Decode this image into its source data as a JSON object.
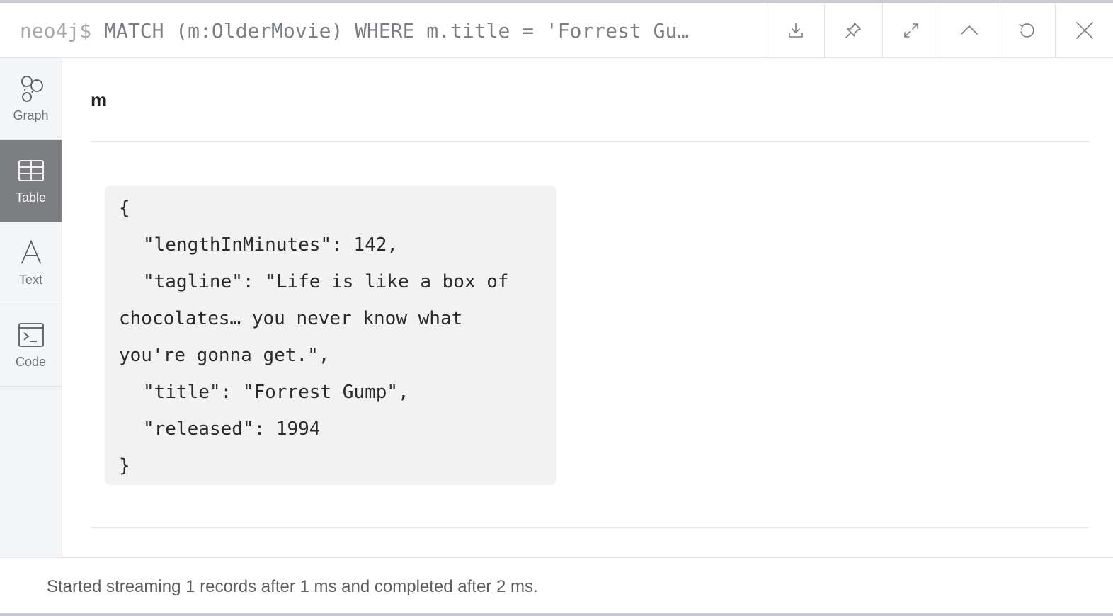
{
  "header": {
    "prompt": "neo4j$",
    "query": "MATCH (m:OlderMovie) WHERE m.title = 'Forrest Gu…",
    "buttons": [
      "download-icon",
      "pin-icon",
      "expand-icon",
      "collapse-up-icon",
      "rerun-icon",
      "close-icon"
    ]
  },
  "sidebar": {
    "items": [
      {
        "label": "Graph",
        "icon": "graph-icon"
      },
      {
        "label": "Table",
        "icon": "table-icon",
        "active": true
      },
      {
        "label": "Text",
        "icon": "text-icon"
      },
      {
        "label": "Code",
        "icon": "code-icon"
      }
    ]
  },
  "result": {
    "column": "m",
    "open_brace": "{",
    "close_brace": "}",
    "line1": "\"lengthInMinutes\": 142,",
    "line2": "\"tagline\": \"Life is like a box of",
    "line3": "chocolates… you never know what",
    "line4": "you're gonna get.\",",
    "line5": "\"title\": \"Forrest Gump\",",
    "line6": "\"released\": 1994"
  },
  "footer": {
    "status": "Started streaming 1 records after 1 ms and completed after 2 ms."
  },
  "colors": {
    "active_tab": "#7c7e81",
    "sidebar_bg": "#f4f5f7",
    "json_bg": "#f2f2f2"
  }
}
